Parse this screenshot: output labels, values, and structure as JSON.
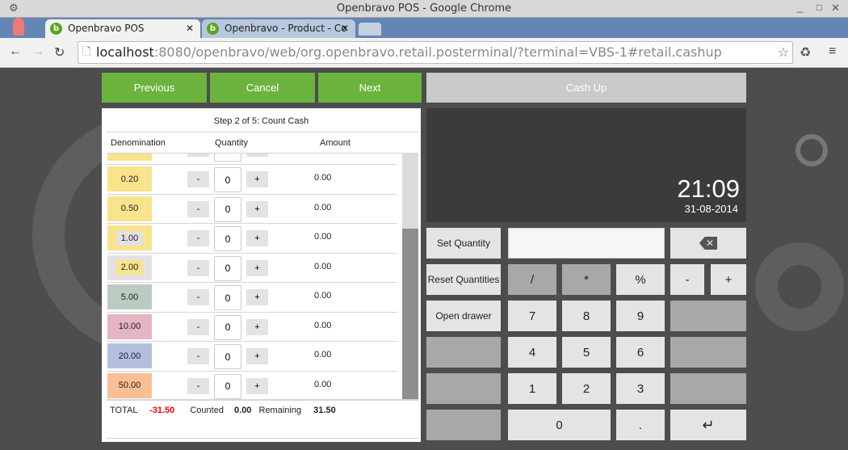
{
  "browser": {
    "window_title": "Openbravo POS - Google Chrome",
    "tabs": [
      {
        "label": "Openbravo POS",
        "active": true
      },
      {
        "label": "Openbravo - Product - Co",
        "active": false
      }
    ],
    "url_host": "localhost",
    "url_rest": ":8080/openbravo/web/org.openbravo.retail.posterminal/?terminal=VBS-1#retail.cashup"
  },
  "toolbar": {
    "previous": "Previous",
    "cancel": "Cancel",
    "next": "Next",
    "cashup": "Cash Up"
  },
  "panel": {
    "step": "Step 2 of 5: Count Cash",
    "columns": [
      "Denomination",
      "Quantity",
      "Amount"
    ],
    "rows": [
      {
        "den": "0.20",
        "qty": "0",
        "amount": "0.00",
        "color": "#f9e48c",
        "inner": "#f9e48c"
      },
      {
        "den": "0.50",
        "qty": "0",
        "amount": "0.00",
        "color": "#f9e48c",
        "inner": "#f9e48c"
      },
      {
        "den": "1.00",
        "qty": "0",
        "amount": "0.00",
        "color": "#f9e48c",
        "inner": "#e4e0e4"
      },
      {
        "den": "2.00",
        "qty": "0",
        "amount": "0.00",
        "color": "#e4e0e4",
        "inner": "#f9e48c"
      },
      {
        "den": "5.00",
        "qty": "0",
        "amount": "0.00",
        "color": "#bccbc2",
        "inner": "#bccbc2"
      },
      {
        "den": "10.00",
        "qty": "0",
        "amount": "0.00",
        "color": "#e6b5c3",
        "inner": "#e6b5c3"
      },
      {
        "den": "20.00",
        "qty": "0",
        "amount": "0.00",
        "color": "#b4bedd",
        "inner": "#b4bedd"
      },
      {
        "den": "50.00",
        "qty": "0",
        "amount": "0.00",
        "color": "#f8bf95",
        "inner": "#f8bf95"
      }
    ],
    "minus": "-",
    "plus": "+",
    "totals": {
      "total_label": "TOTAL",
      "total": "-31.50",
      "counted_label": "Counted",
      "counted": "0.00",
      "remaining_label": "Remaining",
      "remaining": "31.50"
    }
  },
  "clock": {
    "time": "21:09",
    "date": "31-08-2014"
  },
  "keypad": {
    "set_quantity": "Set Quantity",
    "reset_quantities": "Reset Quantities",
    "open_drawer": "Open drawer",
    "input_value": "",
    "keys": [
      "/",
      "*",
      "%",
      "-",
      "+",
      "7",
      "8",
      "9",
      "4",
      "5",
      "6",
      "1",
      "2",
      "3",
      "0",
      "."
    ]
  },
  "colors": {
    "green": "#6cb33e",
    "total_negative": "#ff0000"
  }
}
